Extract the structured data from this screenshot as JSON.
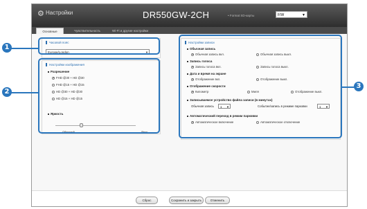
{
  "header": {
    "app_title": "Настройки",
    "model": "DR550GW-2CH",
    "sd_label": "• Format SD-карты",
    "fw_value": "F/W"
  },
  "tabs": [
    {
      "label": "Основные"
    },
    {
      "label": "Чувствительность"
    },
    {
      "label": "Wi-Fi и другие настройки"
    }
  ],
  "timezone": {
    "title": "Часовой пояс",
    "value": "Europe/London"
  },
  "video": {
    "title": "Настройки изображения",
    "resolution_label": "Разрешение",
    "options": [
      "FHD @30 + HD @30",
      "FHD @15 + HD @15",
      "HD @30 + HD @30",
      "HD @15 + HD @15"
    ],
    "selected_index": 0,
    "brightness_label": "Яркость",
    "brightness_min": "Обычный",
    "brightness_max": "Ярко",
    "brightness_level": 0.32
  },
  "record": {
    "title": "Настройки записи",
    "groups": [
      {
        "label": "Обычная запись",
        "options": [
          "Обычная запись вкл.",
          "Обычная запись выкл."
        ],
        "selected": 0
      },
      {
        "label": "Запись голоса",
        "options": [
          "Запись голоса вкл.",
          "Запись голоса выкл."
        ],
        "selected": 0
      },
      {
        "label": "Дата и время на экране",
        "options": [
          "Отображение вкл.",
          "Отображение выкл."
        ],
        "selected": 0
      },
      {
        "label": "Отображение скорости",
        "options": [
          "Километр",
          "Миля",
          "Отображение выкл."
        ],
        "selected": 0
      }
    ],
    "interval_label": "Записываемое устройство файла записи (в минутах)",
    "normal_rec_label": "Обычная запись",
    "normal_rec_value": "1",
    "event_rec_label": "Событие/запись в режиме парковки",
    "event_rec_value": "1",
    "parking_label": "Автоматический переход в режим парковки",
    "parking_options": [
      "Автоматическое включение",
      "Автоматическое отключение"
    ],
    "parking_selected": 0
  },
  "buttons": {
    "reset": "Сброс",
    "save_close": "Сохранить и закрыть",
    "cancel": "Отменить"
  },
  "callouts": [
    "1",
    "2",
    "3"
  ],
  "colors": {
    "accent": "#2a76bd",
    "header_bg": "#3c3c3c"
  }
}
